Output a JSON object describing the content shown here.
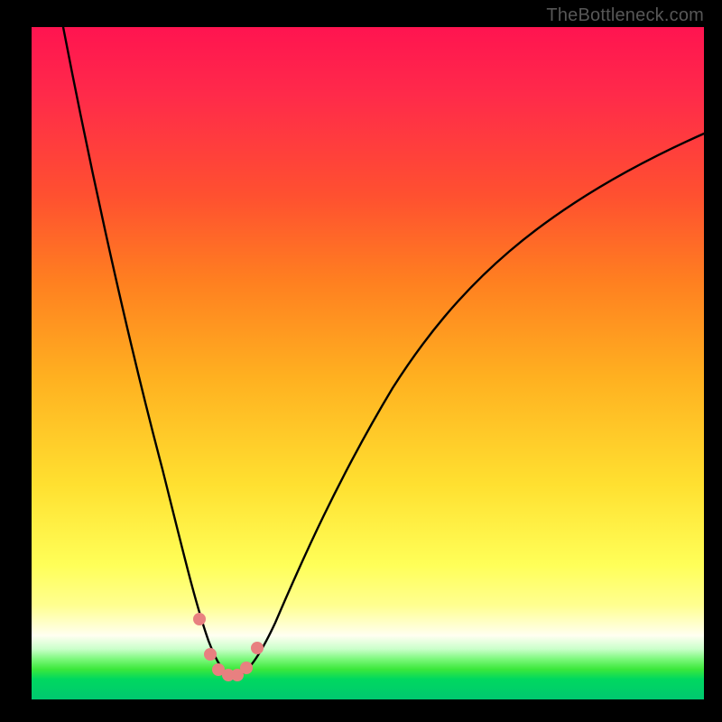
{
  "watermark": "TheBottleneck.com",
  "chart_data": {
    "type": "line",
    "title": "",
    "xlabel": "",
    "ylabel": "",
    "xlim": [
      0,
      100
    ],
    "ylim": [
      0,
      100
    ],
    "series": [
      {
        "name": "bottleneck-curve",
        "x": [
          5,
          10,
          15,
          20,
          24,
          26,
          28,
          30,
          32,
          35,
          40,
          50,
          60,
          70,
          80,
          90,
          100
        ],
        "y": [
          100,
          80,
          58,
          35,
          14,
          6,
          3,
          3,
          6,
          15,
          32,
          53,
          65,
          73,
          79,
          82,
          84
        ]
      }
    ],
    "markers": {
      "name": "highlight-dots",
      "color": "#e88080",
      "points": [
        {
          "x": 24.3,
          "y": 12
        },
        {
          "x": 26.5,
          "y": 6
        },
        {
          "x": 28.0,
          "y": 3
        },
        {
          "x": 30.0,
          "y": 3
        },
        {
          "x": 32.0,
          "y": 6
        },
        {
          "x": 33.5,
          "y": 11
        }
      ]
    }
  }
}
